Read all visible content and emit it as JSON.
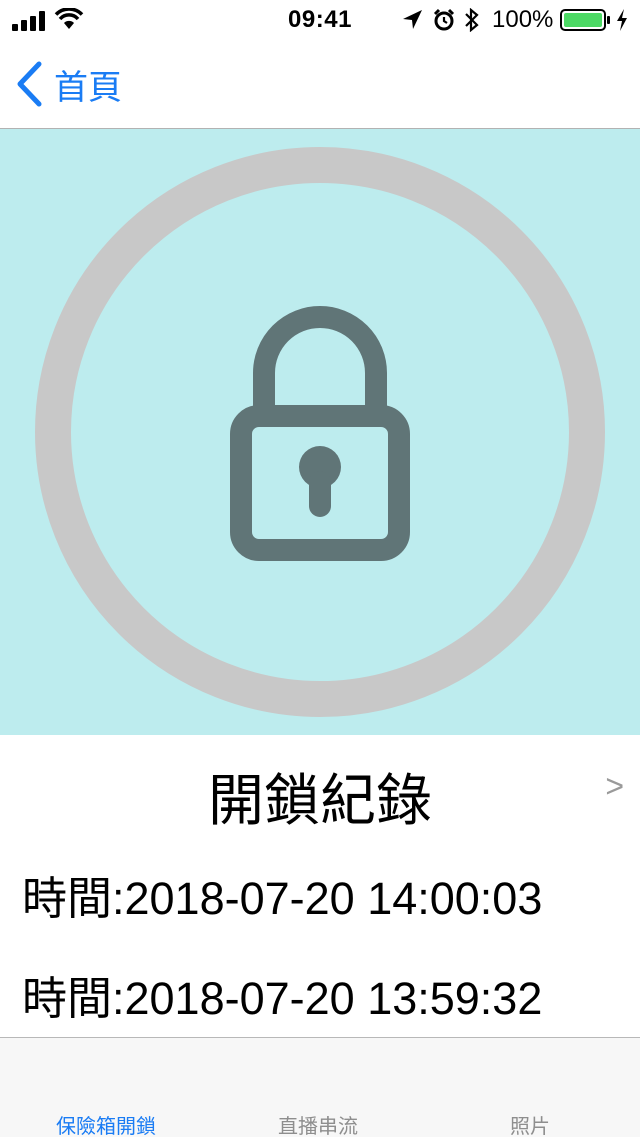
{
  "status_bar": {
    "time": "09:41",
    "battery_percent": "100%",
    "battery_level": 1.0,
    "icons": [
      "signal-icon",
      "wifi-icon",
      "location-arrow-icon",
      "alarm-icon",
      "bluetooth-icon",
      "battery-icon",
      "charging-icon"
    ],
    "colors": {
      "battery_fill": "#4cd964"
    }
  },
  "nav": {
    "back_label": "首頁",
    "back_icon": "chevron-left-icon",
    "accent": "#1a7cf4"
  },
  "lock": {
    "icon": "padlock-icon",
    "state": "locked",
    "colors": {
      "background": "#bdecee",
      "ring": "#c8c8c8",
      "padlock": "#607577"
    }
  },
  "records": {
    "title": "開鎖紀錄",
    "arrow": ">",
    "items": [
      {
        "text": "時間:2018-07-20 14:00:03"
      },
      {
        "text": "時間:2018-07-20 13:59:32"
      }
    ]
  },
  "tabs": [
    {
      "label": "保險箱開鎖",
      "active": true
    },
    {
      "label": "直播串流",
      "active": false
    },
    {
      "label": "照片",
      "active": false
    }
  ]
}
